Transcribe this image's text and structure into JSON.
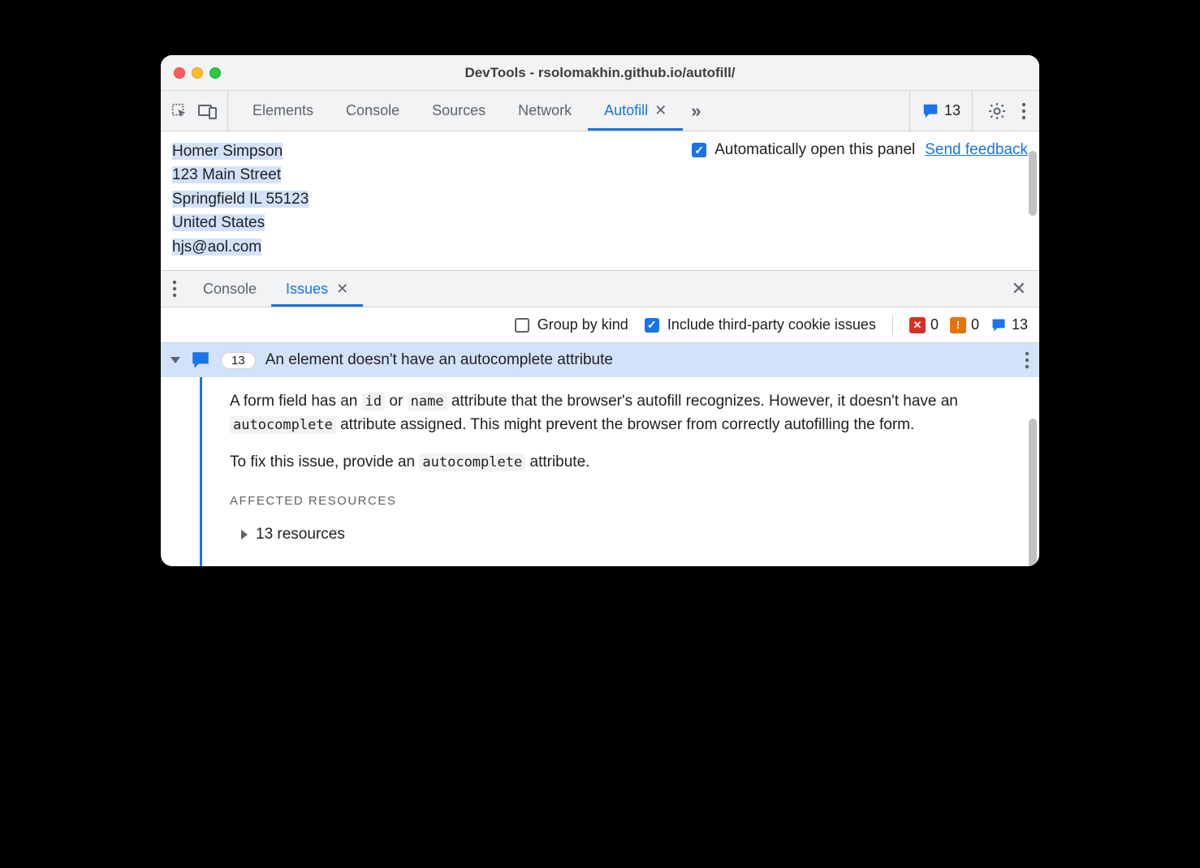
{
  "window": {
    "title": "DevTools - rsolomakhin.github.io/autofill/"
  },
  "toolbar": {
    "tabs": [
      "Elements",
      "Console",
      "Sources",
      "Network",
      "Autofill"
    ],
    "active_tab": "Autofill",
    "issue_count": "13"
  },
  "autofill_panel": {
    "address": {
      "name": "Homer Simpson",
      "street": "123 Main Street",
      "city_state_zip": "Springfield IL 55123",
      "country": "United States",
      "email": "hjs@aol.com"
    },
    "auto_open_label": "Automatically open this panel",
    "auto_open_checked": true,
    "feedback_link": "Send feedback"
  },
  "drawer": {
    "tabs": [
      "Console",
      "Issues"
    ],
    "active_tab": "Issues"
  },
  "issues_toolbar": {
    "group_by_kind_label": "Group by kind",
    "group_by_kind_checked": false,
    "third_party_label": "Include third-party cookie issues",
    "third_party_checked": true,
    "counts": {
      "error": "0",
      "warning": "0",
      "info": "13"
    }
  },
  "issue": {
    "count": "13",
    "title": "An element doesn't have an autocomplete attribute",
    "desc1_a": "A form field has an ",
    "desc1_code1": "id",
    "desc1_b": " or ",
    "desc1_code2": "name",
    "desc1_c": " attribute that the browser's autofill recognizes. However, it doesn't have an ",
    "desc1_code3": "autocomplete",
    "desc1_d": " attribute assigned. This might prevent the browser from correctly autofilling the form.",
    "desc2_a": "To fix this issue, provide an ",
    "desc2_code": "autocomplete",
    "desc2_b": " attribute.",
    "affected_label": "AFFECTED RESOURCES",
    "resources_summary": "13 resources"
  }
}
